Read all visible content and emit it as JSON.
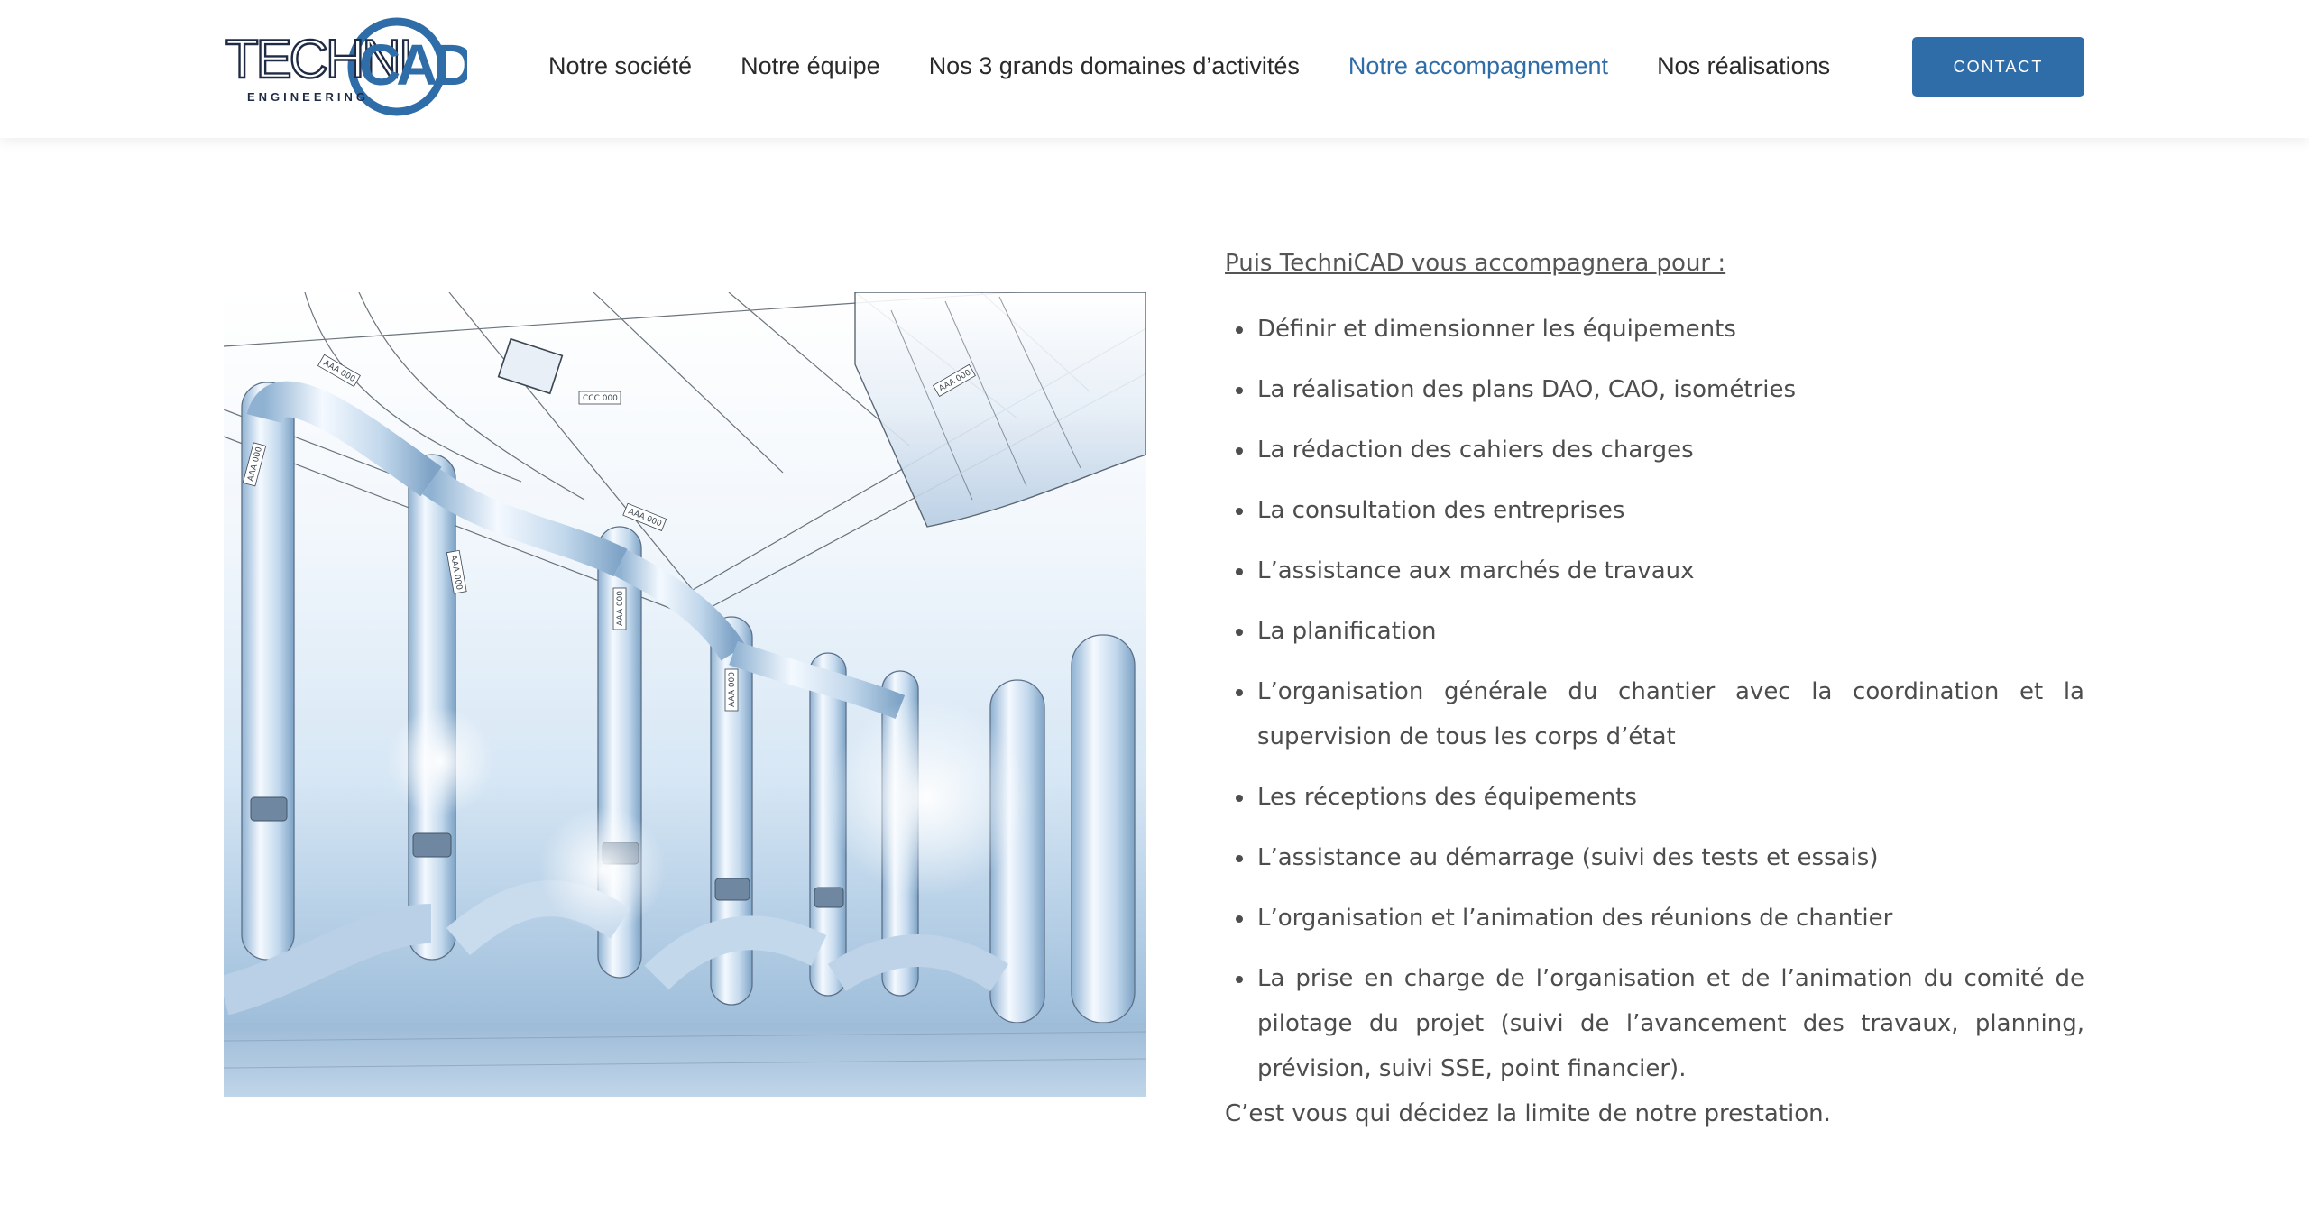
{
  "brand": {
    "logo_main_left": "TECHNI",
    "logo_main_right": "CAD",
    "logo_sub": "ENGINEERING",
    "primary_color": "#2f6da8",
    "dark_color": "#1f2a44"
  },
  "nav": {
    "items": [
      {
        "label": "Notre société"
      },
      {
        "label": "Notre équipe"
      },
      {
        "label": "Nos 3 grands domaines d’activités"
      },
      {
        "label": "Notre accompagnement"
      },
      {
        "label": "Nos réalisations"
      }
    ],
    "active_index": 3,
    "contact_label": "CONTACT"
  },
  "content": {
    "intro": "Puis TechniCAD vous accompagnera pour :",
    "items": [
      "Définir et dimensionner les équipements",
      "La réalisation des plans DAO, CAO, isométries",
      "La rédaction des cahiers des charges",
      "La consultation des entreprises",
      "L’assistance aux marchés de travaux",
      "La planification",
      "L’organisation générale du chantier avec la coordination et la supervision de tous les corps d’état",
      "Les réceptions des équipements",
      "L’assistance au démarrage (suivi des tests et essais)",
      "L’organisation et l’animation des réunions de chantier",
      "La prise en charge de l’organisation et de l’animation du comité de pilotage du projet (suivi de l’avancement des travaux, planning, prévision, suivi SSE, point financier)."
    ],
    "outro": "C’est vous qui décidez la limite de notre prestation."
  },
  "illustration": {
    "labels": [
      "AAA 000",
      "CCC 000",
      "AAA 000",
      "AAA 000",
      "AAA 000",
      "AAA 000",
      "AAA 000",
      "AAA 000"
    ]
  }
}
